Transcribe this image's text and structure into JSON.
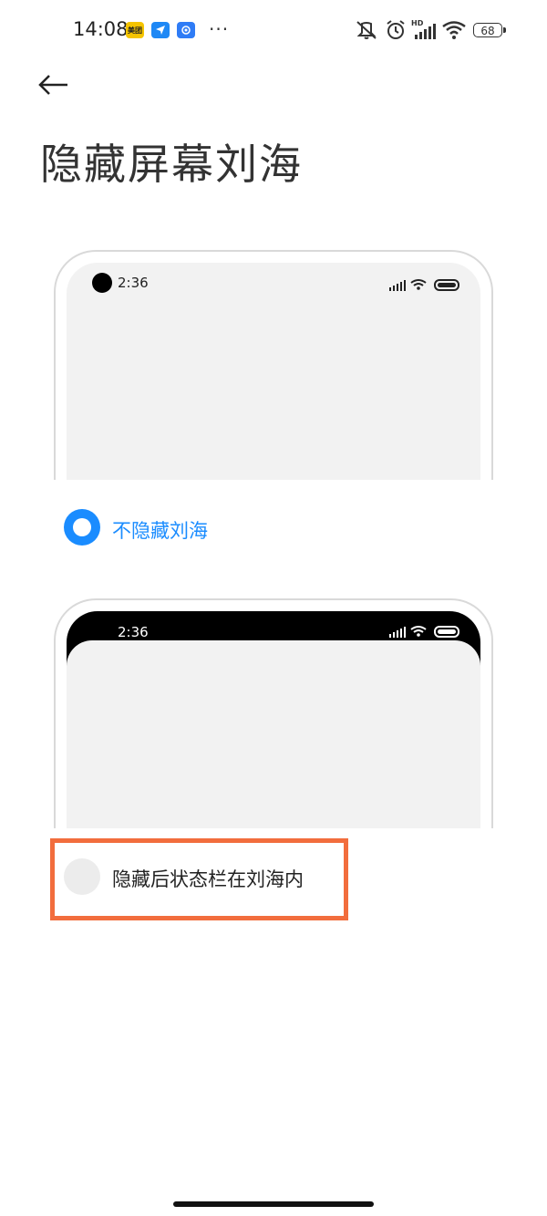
{
  "status_bar": {
    "time": "14:08",
    "apps": [
      {
        "name": "meituan-icon",
        "label": "美团"
      },
      {
        "name": "feishu-icon",
        "label": ""
      },
      {
        "name": "app-icon",
        "label": ""
      }
    ],
    "more": "···",
    "battery": "68"
  },
  "header": {
    "back_icon": "arrow-left-icon",
    "title": "隐藏屏幕刘海"
  },
  "options": [
    {
      "preview_time": "2:36",
      "label": "不隐藏刘海",
      "selected": true,
      "accent": "#1a8cff"
    },
    {
      "preview_time": "2:36",
      "label": "隐藏后状态栏在刘海内",
      "selected": false
    }
  ],
  "highlight_color": "#f26d3d"
}
